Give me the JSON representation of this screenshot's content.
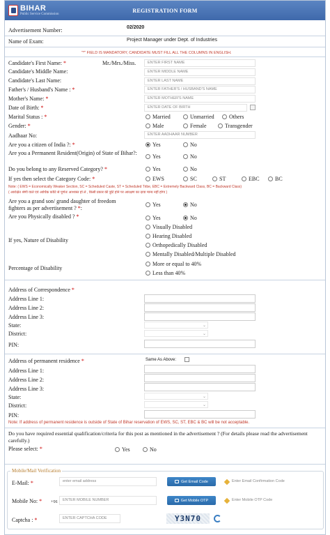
{
  "header": {
    "logo_text": "BIHAR",
    "logo_sub": "Public Service Commission",
    "title": "REGISTRATION FORM"
  },
  "advert": {
    "number_label": "Advertisement Number:",
    "number_value": "02/2020",
    "exam_label": "Name of Exam:",
    "exam_value": "Project Manager under Dept. of Industries",
    "mandatory_note": "\"*\" FIELD IS MANDATORY, CANDIDATE MUST FILL ALL THE COLUMNS IN ENGLISH."
  },
  "personal": {
    "first_name_label": "Candidate's First Name:",
    "salutation": "Mr./Mrs./Miss.",
    "first_name_placeholder": "ENTER FIRST NAME",
    "middle_name_label": "Candidate's Middle Name:",
    "middle_name_placeholder": "ENTER MIDDLE NAME",
    "last_name_label": "Candidate's Last Name:",
    "last_name_placeholder": "ENTER LAST NAME",
    "father_label": "Father's / Husband's Name :",
    "father_placeholder": "ENTER FATHER'S / HUSBAND'S NAME",
    "mother_label": "Mother's Name:",
    "mother_placeholder": "ENTER MOTHER'S NAME",
    "dob_label": "Date of Birth:",
    "dob_placeholder": "ENTER DATE OF BIRTH",
    "marital_label": "Marital Status :",
    "marital_options": [
      "Married",
      "Unmarried",
      "Others"
    ],
    "gender_label": "Gender:",
    "gender_options": [
      "Male",
      "Female",
      "Transgender"
    ],
    "aadhaar_label": "Aadhaar No:",
    "aadhaar_placeholder": "ENTER AADHAAR NUMBER"
  },
  "questions": {
    "citizen_label": "Are you a citizen of India ?:",
    "citizen_yes": "Yes",
    "citizen_no": "No",
    "resident_label": "Are you a Permanent Resident(Origin) of State of Bihar?:",
    "resident_yes": "Yes",
    "resident_no": "No",
    "reserved_label": "Do you belong to any Reserved Category?",
    "reserved_yes": "Yes",
    "reserved_no": "No",
    "category_label": "If yes then select the Category Code:",
    "category_options": [
      "EWS",
      "SC",
      "ST",
      "EBC",
      "BC"
    ],
    "category_note_en": "Note: ( EWS = Economically Weaker Section, SC = Scheduled Caste, ST = Scheduled Tribe, EBC = Extremely Backward Class, BC = Backward Class)",
    "category_note_hi": "( आरक्षित श्रेणी वाले एवं आर्थिक कोटि से पूर्णतः आश्वस्त हो लें , किसी प्रकार की त्रुटि होने पर आरक्षण का दावा मान्य नहीं होगा )",
    "freedom_label": "Are you a grand son/ grand daughter of freedom fighters as per advertisement ?",
    "freedom_yes": "Yes",
    "freedom_no": "No",
    "disabled_label": "Are you Physically disabled ?",
    "disabled_yes": "Yes",
    "disabled_no": "No",
    "nature_label": "If yes, Nature of Disability",
    "nature_options": [
      "Visually Disabled",
      "Hearing Disabled",
      "Orthopedically Disabled",
      "Mentally Disabled/Multiple Disabled"
    ],
    "percentage_label": "Percentage of Disability",
    "percentage_options": [
      "More or equal to 40%",
      "Less than 40%"
    ]
  },
  "correspondence": {
    "heading": "Address of Correspondence",
    "line1": "Address Line 1:",
    "line2": "Address Line 2:",
    "line3": "Address Line 3:",
    "state": "State:",
    "district": "District:",
    "pin": "PIN:"
  },
  "permanent": {
    "heading": "Address of permanent residence",
    "same_as_above": "Same As Above:",
    "line1": "Address Line 1:",
    "line2": "Address Line 2:",
    "line3": "Address Line 3:",
    "state": "State:",
    "district": "District:",
    "pin": "PIN:",
    "note": "Note: If address of permanent residence is outside of State of Bihar reservation of EWS, SC, ST, EBC & BC will be not acceptable."
  },
  "qualification": {
    "question": "Do you have required essential qualification/criteria for this post as mentioned in the advertisement ? (For details please read the advertisement carefully.)",
    "select_label": "Please select:",
    "yes": "Yes",
    "no": "No"
  },
  "verification": {
    "legend": "Mobile/Mail Verification",
    "email_label": "E-Mail:",
    "email_placeholder": "enter email address",
    "email_button": "Get Email Code",
    "email_code_placeholder": "Enter Email Confirmation Code",
    "mobile_label": "Mobile No:",
    "mobile_prefix": "+91",
    "mobile_placeholder": "ENTER MOBILE NUMBER",
    "mobile_button": "Get Mobile OTP",
    "mobile_code_placeholder": "Enter Mobile OTP Code",
    "captcha_label": "Captcha :",
    "captcha_placeholder": "ENTER CAPTCHA CODE",
    "captcha_text": "Y3N70"
  },
  "colors": {
    "header": "#4a75b8",
    "required": "#cc0000",
    "button": "#3579bd"
  }
}
